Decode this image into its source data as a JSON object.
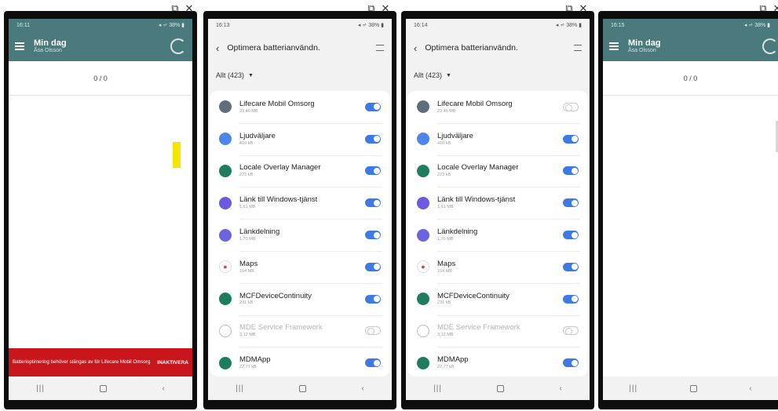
{
  "window_controls": {
    "restore": "⧉",
    "close": "✕"
  },
  "phones": [
    {
      "status_time": "16:11",
      "status_right": "◂ ⩫ 38% ▮"
    },
    {
      "status_time": "16:13",
      "status_right": "◂ ⩫ 38% ▮"
    },
    {
      "status_time": "16:14",
      "status_right": "◂ ⩫ 38% ▮"
    },
    {
      "status_time": "16:15",
      "status_right": "◂ ⩫ 38% ▮"
    }
  ],
  "app": {
    "title": "Min dag",
    "user": "Åsa Olsson",
    "counter": "0 / 0",
    "banner_message": "Batterioptimering behöver stängas av för Lifecare Mobil Omsorg",
    "banner_action": "INAKTIVERA"
  },
  "settings": {
    "title": "Optimera batterianvändn.",
    "filter": "Allt (423)",
    "apps": [
      {
        "name": "Lifecare Mobil Omsorg",
        "size": "23,46 MB",
        "icon": "lifecare-icon",
        "color": "#5f6e7a"
      },
      {
        "name": "Ljudväljare",
        "size": "410 kB",
        "icon": "music-note-icon",
        "color": "#4b86e8"
      },
      {
        "name": "Locale Overlay Manager",
        "size": "223 kB",
        "icon": "android-icon",
        "color": "#1f7d5f"
      },
      {
        "name": "Länk till Windows-tjänst",
        "size": "1,61 MB",
        "icon": "windows-link-icon",
        "color": "#6a5ae0"
      },
      {
        "name": "Länkdelning",
        "size": "1,70 MB",
        "icon": "cloud-share-icon",
        "color": "#6c63e0"
      },
      {
        "name": "Maps",
        "size": "104 MB",
        "icon": "maps-pin-icon",
        "color": "#ffffff"
      },
      {
        "name": "MCFDeviceContinuity",
        "size": "231 kB",
        "icon": "android-icon",
        "color": "#1f7d5f"
      },
      {
        "name": "MDE Service Framework",
        "size": "3,12 MB",
        "icon": "mde-icon",
        "color": "#bbbbbb"
      },
      {
        "name": "MDMApp",
        "size": "22,77 kB",
        "icon": "android-icon",
        "color": "#1f7d5f"
      }
    ],
    "toggles_screen2": [
      true,
      true,
      true,
      true,
      true,
      true,
      true,
      false,
      true
    ],
    "toggles_screen3": [
      false,
      true,
      true,
      true,
      true,
      true,
      true,
      false,
      true
    ],
    "disabled": [
      false,
      false,
      false,
      false,
      false,
      false,
      false,
      true,
      false
    ]
  },
  "nav": {
    "recent": "|||",
    "back": "‹"
  }
}
